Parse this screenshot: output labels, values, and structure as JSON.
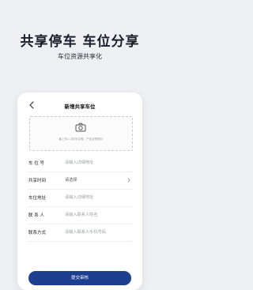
{
  "hero": {
    "title": "共享停车  车位分享",
    "subtitle": "车位资源共享化"
  },
  "screen": {
    "title": "新增共享车位",
    "upload_hint": "最上传1-3张车位照、产权证等照片",
    "fields": [
      {
        "label": "车 位 号",
        "value": "请输入详细地址"
      },
      {
        "label": "共享时间",
        "value": "请选择"
      },
      {
        "label": "车位地址",
        "value": "请输入详细地址"
      },
      {
        "label": "联 系 人",
        "value": "请输入联系人姓名"
      },
      {
        "label": "联系方式",
        "value": "请输入联系人手机号码"
      }
    ],
    "submit_label": "提交审核"
  },
  "icons": {
    "back": "chevron-left-icon",
    "camera": "camera-icon",
    "select": "chevron-right-icon"
  },
  "colors": {
    "background": "#eef0f3",
    "primary": "#1e3f8f"
  }
}
